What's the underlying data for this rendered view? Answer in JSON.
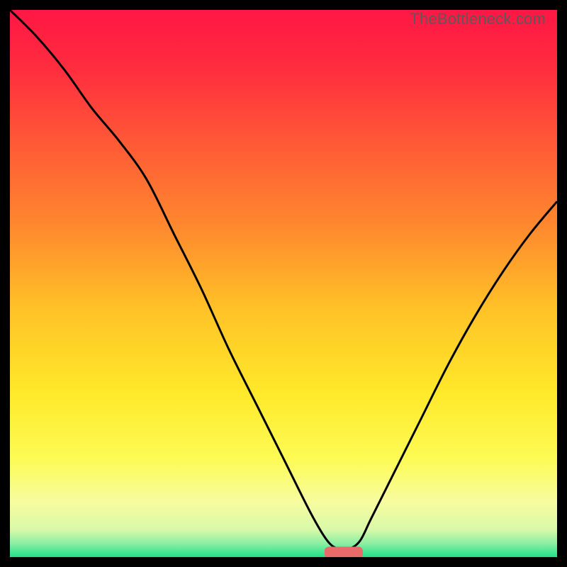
{
  "watermark": "TheBottleneck.com",
  "chart_data": {
    "type": "line",
    "title": "",
    "xlabel": "",
    "ylabel": "",
    "xlim": [
      0,
      100
    ],
    "ylim": [
      0,
      100
    ],
    "grid": false,
    "legend": {
      "visible": false
    },
    "background": {
      "type": "vertical-gradient",
      "stops": [
        {
          "pos": 0.0,
          "color": "#ff1744"
        },
        {
          "pos": 0.1,
          "color": "#ff2b3f"
        },
        {
          "pos": 0.25,
          "color": "#ff5b36"
        },
        {
          "pos": 0.4,
          "color": "#ff8a2e"
        },
        {
          "pos": 0.55,
          "color": "#ffc327"
        },
        {
          "pos": 0.7,
          "color": "#ffe92a"
        },
        {
          "pos": 0.82,
          "color": "#fdfb55"
        },
        {
          "pos": 0.9,
          "color": "#f7fca0"
        },
        {
          "pos": 0.95,
          "color": "#d8f9a8"
        },
        {
          "pos": 0.975,
          "color": "#8ceea4"
        },
        {
          "pos": 1.0,
          "color": "#1fe288"
        }
      ]
    },
    "series": [
      {
        "name": "bottleneck-curve",
        "color": "#000000",
        "stroke_width": 3,
        "x": [
          0,
          5,
          10,
          15,
          20,
          25,
          30,
          35,
          40,
          45,
          50,
          55,
          58,
          60,
          62,
          64,
          66,
          70,
          75,
          80,
          85,
          90,
          95,
          100
        ],
        "y": [
          100,
          95,
          89,
          82,
          76,
          69,
          59,
          49,
          38,
          28,
          18,
          8,
          3,
          1.5,
          1.5,
          3,
          7,
          15,
          25,
          35,
          44,
          52,
          59,
          65
        ]
      }
    ],
    "marker": {
      "name": "optimal-marker",
      "shape": "rounded-rect",
      "color": "#e86a6a",
      "x_center": 61,
      "y": 0.8,
      "width_x": 7,
      "height_y": 2.2
    }
  }
}
